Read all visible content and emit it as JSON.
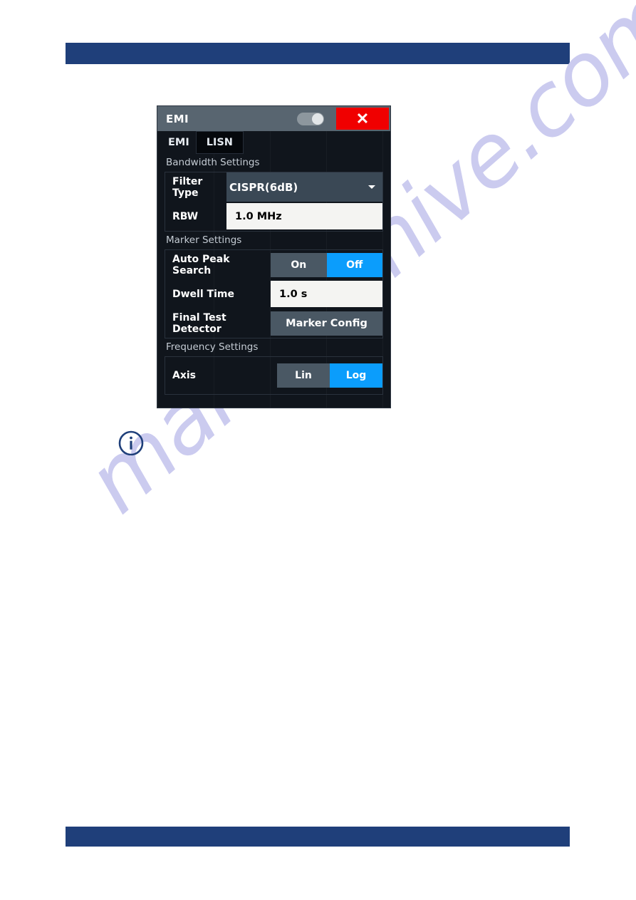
{
  "page": {
    "watermark_text": "manualshive.com",
    "header_bar_color": "#1f3f7a",
    "footer_bar_color": "#1f3f7a",
    "background_color": "#ffffff"
  },
  "note": {
    "icon": "info-circle-icon",
    "icon_color": "#1f3f7a"
  },
  "dialog": {
    "title": "EMI",
    "enable_toggle": {
      "name": "enable-toggle",
      "state": "on"
    },
    "close_label": "✕",
    "tabs": [
      {
        "label": "EMI",
        "active": true
      },
      {
        "label": "LISN",
        "active": false
      }
    ],
    "sections": [
      {
        "label": "Bandwidth Settings",
        "rows": [
          {
            "label": "Filter Type",
            "type": "dropdown",
            "value": "CISPR(6dB)",
            "arrow_icon": "chevron-down-icon"
          },
          {
            "label": "RBW",
            "type": "input",
            "value": "1.0 MHz",
            "placeholder": "1.0 MHz"
          }
        ]
      },
      {
        "label": "Marker Settings",
        "rows": [
          {
            "label": "Auto Peak Search",
            "type": "segmented",
            "options": [
              "On",
              "Off"
            ],
            "selected": "Off"
          },
          {
            "label": "Dwell Time",
            "type": "input",
            "value": "1.0 s",
            "placeholder": "1.0 s"
          },
          {
            "label": "Final Test Detector",
            "type": "button",
            "value": "Marker Config"
          }
        ]
      },
      {
        "label": "Frequency Settings",
        "rows": [
          {
            "label": "Axis",
            "type": "segmented",
            "options": [
              "Lin",
              "Log"
            ],
            "selected": "Log"
          }
        ]
      }
    ],
    "colors": {
      "titlebar": "#586570",
      "close_red": "#f00000",
      "accent_blue": "#0b9dfc",
      "panel_dark": "#10151c",
      "control_gray": "#4a5864",
      "dropdown_gray": "#3a4855",
      "input_white": "#f4f4f2"
    }
  }
}
